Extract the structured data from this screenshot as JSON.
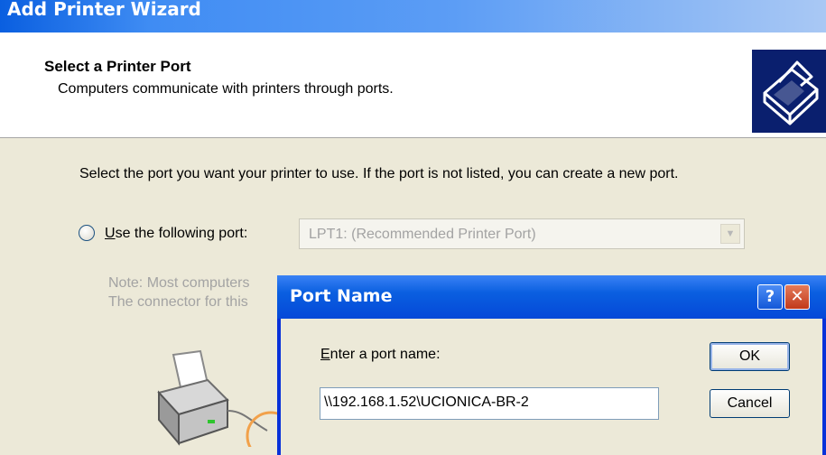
{
  "wizard": {
    "title": "Add Printer Wizard",
    "header_title": "Select a Printer Port",
    "header_subtitle": "Computers communicate with printers through ports.",
    "header_icon": "printer-icon"
  },
  "body": {
    "intro": "Select the port you want your printer to use.  If the port is not listed, you can create a new port.",
    "radio_label_prefix": "U",
    "radio_label_rest": "se the following port:",
    "port_value": "LPT1: (Recommended Printer Port)",
    "note_line1": "Note: Most computers",
    "note_line2": "The connector for this"
  },
  "dialog": {
    "title": "Port Name",
    "help_glyph": "?",
    "close_glyph": "✕",
    "label_prefix": "E",
    "label_rest": "nter a port name:",
    "input_value": "\\\\192.168.1.52\\UCIONICA-BR-2",
    "ok": "OK",
    "cancel": "Cancel"
  },
  "colors": {
    "titlebar_blue": "#0a5fe0",
    "dialog_bg": "#ece9d8",
    "close_red": "#c1391a"
  }
}
